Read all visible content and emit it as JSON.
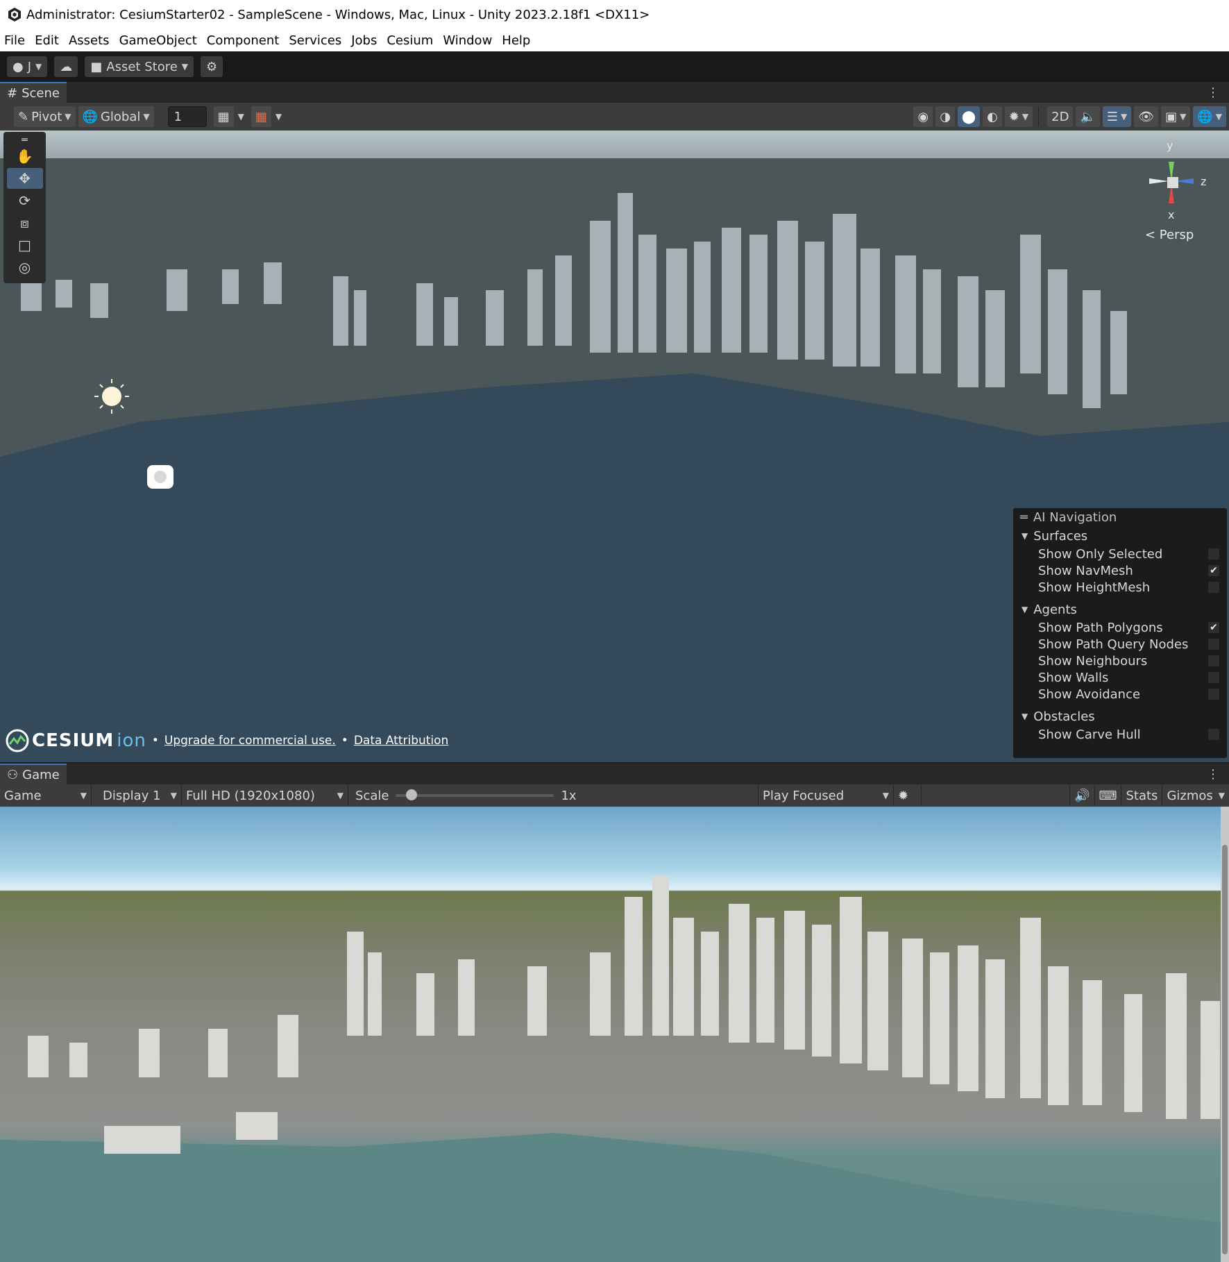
{
  "window": {
    "title": "Administrator: CesiumStarter02 - SampleScene - Windows, Mac, Linux - Unity 2023.2.18f1 <DX11>"
  },
  "menu": [
    "File",
    "Edit",
    "Assets",
    "GameObject",
    "Component",
    "Services",
    "Jobs",
    "Cesium",
    "Window",
    "Help"
  ],
  "toolbar": {
    "account_label": "J",
    "asset_store_label": "Asset Store"
  },
  "scene": {
    "tab_label": "Scene",
    "pivot_label": "Pivot",
    "global_label": "Global",
    "grid_value": "1",
    "mode_2d_label": "2D",
    "projection_label": "< Persp",
    "axis_y": "y",
    "axis_z": "z",
    "axis_x": "x"
  },
  "ai_navigation": {
    "title": "AI Navigation",
    "sections": [
      {
        "label": "Surfaces",
        "items": [
          {
            "label": "Show Only Selected",
            "checked": false
          },
          {
            "label": "Show NavMesh",
            "checked": true
          },
          {
            "label": "Show HeightMesh",
            "checked": false
          }
        ]
      },
      {
        "label": "Agents",
        "items": [
          {
            "label": "Show Path Polygons",
            "checked": true
          },
          {
            "label": "Show Path Query Nodes",
            "checked": false
          },
          {
            "label": "Show Neighbours",
            "checked": false
          },
          {
            "label": "Show Walls",
            "checked": false
          },
          {
            "label": "Show Avoidance",
            "checked": false
          }
        ]
      },
      {
        "label": "Obstacles",
        "items": [
          {
            "label": "Show Carve Hull",
            "checked": false
          }
        ]
      }
    ]
  },
  "credits": {
    "logo_text": "CESIUM",
    "logo_suffix": "ion",
    "bullet": "•",
    "upgrade_link": "Upgrade for commercial use.",
    "attribution_link": "Data Attribution"
  },
  "game": {
    "tab_label": "Game",
    "view_mode": "Game",
    "display": "Display 1",
    "resolution": "Full HD (1920x1080)",
    "scale_label": "Scale",
    "scale_value": "1x",
    "scale_fraction": 0.07,
    "play_mode": "Play Focused",
    "stats_label": "Stats",
    "gizmos_label": "Gizmos"
  },
  "colors": {
    "accent": "#3a79bb",
    "active_button": "#46607c",
    "panel_bg": "#3c3c3c"
  }
}
